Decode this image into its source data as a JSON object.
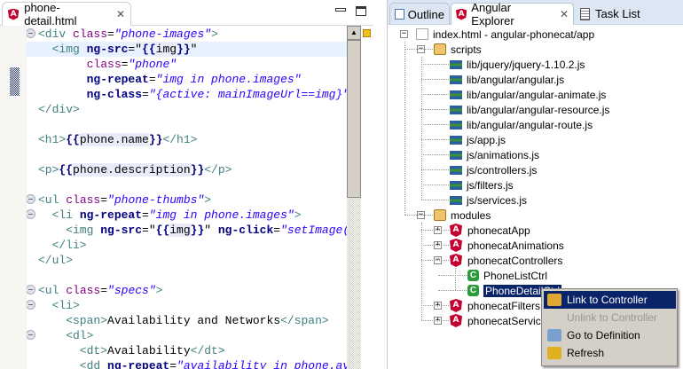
{
  "editor": {
    "tab_title": "phone-detail.html",
    "lines": [
      {
        "fold": true,
        "cur": false,
        "tokens": [
          [
            "t",
            "<div "
          ],
          [
            "a",
            "class"
          ],
          [
            "p",
            "="
          ],
          [
            "s",
            "\"phone-images\""
          ],
          [
            "t",
            ">"
          ]
        ]
      },
      {
        "fold": false,
        "cur": true,
        "tokens": [
          [
            "t",
            "  <img "
          ],
          [
            "k",
            "ng-src"
          ],
          [
            "p",
            "=\""
          ],
          [
            "k",
            "{{"
          ],
          [
            "e",
            "img"
          ],
          [
            "k",
            "}}"
          ],
          [
            "p",
            "\""
          ]
        ]
      },
      {
        "fold": false,
        "cur": false,
        "tokens": [
          [
            "p",
            "       "
          ],
          [
            "a",
            "class"
          ],
          [
            "p",
            "="
          ],
          [
            "s",
            "\"phone\""
          ]
        ]
      },
      {
        "fold": false,
        "cur": false,
        "tokens": [
          [
            "p",
            "       "
          ],
          [
            "k",
            "ng-repeat"
          ],
          [
            "p",
            "="
          ],
          [
            "s",
            "\"img in phone.images\""
          ]
        ]
      },
      {
        "fold": false,
        "cur": false,
        "tokens": [
          [
            "p",
            "       "
          ],
          [
            "k",
            "ng-class"
          ],
          [
            "p",
            "="
          ],
          [
            "s",
            "\"{active: mainImageUrl==img}\""
          ]
        ]
      },
      {
        "fold": false,
        "cur": false,
        "tokens": [
          [
            "t",
            "</div>"
          ]
        ]
      },
      {
        "fold": false,
        "cur": false,
        "tokens": []
      },
      {
        "fold": false,
        "cur": false,
        "tokens": [
          [
            "t",
            "<h1>"
          ],
          [
            "k",
            "{{"
          ],
          [
            "e",
            "phone.name"
          ],
          [
            "k",
            "}}"
          ],
          [
            "t",
            "</h1>"
          ]
        ]
      },
      {
        "fold": false,
        "cur": false,
        "tokens": []
      },
      {
        "fold": false,
        "cur": false,
        "tokens": [
          [
            "t",
            "<p>"
          ],
          [
            "k",
            "{{"
          ],
          [
            "e",
            "phone.description"
          ],
          [
            "k",
            "}}"
          ],
          [
            "t",
            "</p>"
          ]
        ]
      },
      {
        "fold": false,
        "cur": false,
        "tokens": []
      },
      {
        "fold": true,
        "cur": false,
        "tokens": [
          [
            "t",
            "<ul "
          ],
          [
            "a",
            "class"
          ],
          [
            "p",
            "="
          ],
          [
            "s",
            "\"phone-thumbs\""
          ],
          [
            "t",
            ">"
          ]
        ]
      },
      {
        "fold": true,
        "cur": false,
        "tokens": [
          [
            "t",
            "  <li "
          ],
          [
            "k",
            "ng-repeat"
          ],
          [
            "p",
            "="
          ],
          [
            "s",
            "\"img in phone.images\""
          ],
          [
            "t",
            ">"
          ]
        ]
      },
      {
        "fold": false,
        "cur": false,
        "tokens": [
          [
            "t",
            "    <img "
          ],
          [
            "k",
            "ng-src"
          ],
          [
            "p",
            "=\""
          ],
          [
            "k",
            "{{"
          ],
          [
            "e",
            "img"
          ],
          [
            "k",
            "}}"
          ],
          [
            "p",
            "\" "
          ],
          [
            "k",
            "ng-click"
          ],
          [
            "p",
            "="
          ],
          [
            "s",
            "\"setImage(img)\""
          ]
        ]
      },
      {
        "fold": false,
        "cur": false,
        "tokens": [
          [
            "t",
            "  </li>"
          ]
        ]
      },
      {
        "fold": false,
        "cur": false,
        "tokens": [
          [
            "t",
            "</ul>"
          ]
        ]
      },
      {
        "fold": false,
        "cur": false,
        "tokens": []
      },
      {
        "fold": true,
        "cur": false,
        "tokens": [
          [
            "t",
            "<ul "
          ],
          [
            "a",
            "class"
          ],
          [
            "p",
            "="
          ],
          [
            "s",
            "\"specs\""
          ],
          [
            "t",
            ">"
          ]
        ]
      },
      {
        "fold": true,
        "cur": false,
        "tokens": [
          [
            "t",
            "  <li>"
          ]
        ]
      },
      {
        "fold": false,
        "cur": false,
        "tokens": [
          [
            "t",
            "    <span>"
          ],
          [
            "p",
            "Availability and Networks"
          ],
          [
            "t",
            "</span>"
          ]
        ]
      },
      {
        "fold": true,
        "cur": false,
        "tokens": [
          [
            "t",
            "    <dl>"
          ]
        ]
      },
      {
        "fold": false,
        "cur": false,
        "tokens": [
          [
            "t",
            "      <dt>"
          ],
          [
            "p",
            "Availability"
          ],
          [
            "t",
            "</dt>"
          ]
        ]
      },
      {
        "fold": false,
        "cur": false,
        "tokens": [
          [
            "t",
            "      <dd "
          ],
          [
            "k",
            "ng-repeat"
          ],
          [
            "p",
            "="
          ],
          [
            "s",
            "\"availability in phone.availability\""
          ]
        ]
      }
    ]
  },
  "panel": {
    "tabs": [
      {
        "label": "Outline",
        "icon": "outline-icon"
      },
      {
        "label": "Angular Explorer",
        "icon": "angular-icon"
      },
      {
        "label": "Task List",
        "icon": "task-list-icon"
      }
    ],
    "tree": [
      {
        "label": "index.html - angular-phonecat/app",
        "level": 0,
        "expander": "-",
        "icon": "html-file-icon"
      },
      {
        "label": "scripts",
        "level": 1,
        "expander": "-",
        "icon": "folder-icon"
      },
      {
        "label": "lib/jquery/jquery-1.10.2.js",
        "level": 2,
        "expander": "",
        "icon": "script-icon"
      },
      {
        "label": "lib/angular/angular.js",
        "level": 2,
        "expander": "",
        "icon": "script-icon"
      },
      {
        "label": "lib/angular/angular-animate.js",
        "level": 2,
        "expander": "",
        "icon": "script-icon"
      },
      {
        "label": "lib/angular/angular-resource.js",
        "level": 2,
        "expander": "",
        "icon": "script-icon"
      },
      {
        "label": "lib/angular/angular-route.js",
        "level": 2,
        "expander": "",
        "icon": "script-icon"
      },
      {
        "label": "js/app.js",
        "level": 2,
        "expander": "",
        "icon": "script-icon"
      },
      {
        "label": "js/animations.js",
        "level": 2,
        "expander": "",
        "icon": "script-icon"
      },
      {
        "label": "js/controllers.js",
        "level": 2,
        "expander": "",
        "icon": "script-icon"
      },
      {
        "label": "js/filters.js",
        "level": 2,
        "expander": "",
        "icon": "script-icon"
      },
      {
        "label": "js/services.js",
        "level": 2,
        "expander": "",
        "icon": "script-icon"
      },
      {
        "label": "modules",
        "level": 1,
        "expander": "-",
        "icon": "folder-icon"
      },
      {
        "label": "phonecatApp",
        "level": 2,
        "expander": "+",
        "icon": "angular-module-icon"
      },
      {
        "label": "phonecatAnimations",
        "level": 2,
        "expander": "+",
        "icon": "angular-module-icon"
      },
      {
        "label": "phonecatControllers",
        "level": 2,
        "expander": "-",
        "icon": "angular-module-icon"
      },
      {
        "label": "PhoneListCtrl",
        "level": 3,
        "expander": "",
        "icon": "controller-icon"
      },
      {
        "label": "PhoneDetailCtrl",
        "level": 3,
        "expander": "",
        "icon": "controller-icon",
        "selected": true
      },
      {
        "label": "phonecatFilters",
        "level": 2,
        "expander": "+",
        "icon": "angular-module-icon"
      },
      {
        "label": "phonecatServices",
        "level": 2,
        "expander": "+",
        "icon": "angular-module-icon"
      }
    ]
  },
  "context_menu": [
    {
      "label": "Link to Controller",
      "icon": "link-icon",
      "highlighted": true,
      "disabled": false
    },
    {
      "label": "Unlink to Controller",
      "icon": "",
      "highlighted": false,
      "disabled": true
    },
    {
      "label": "Go to Definition",
      "icon": "go-to-definition-icon",
      "highlighted": false,
      "disabled": false
    },
    {
      "label": "Refresh",
      "icon": "refresh-icon",
      "highlighted": false,
      "disabled": false
    }
  ],
  "colors": {
    "selection": "#0a246a",
    "tag": "#3f7f7f",
    "attr": "#7f007f",
    "string": "#2a00ff",
    "angular": "#c3002f"
  }
}
